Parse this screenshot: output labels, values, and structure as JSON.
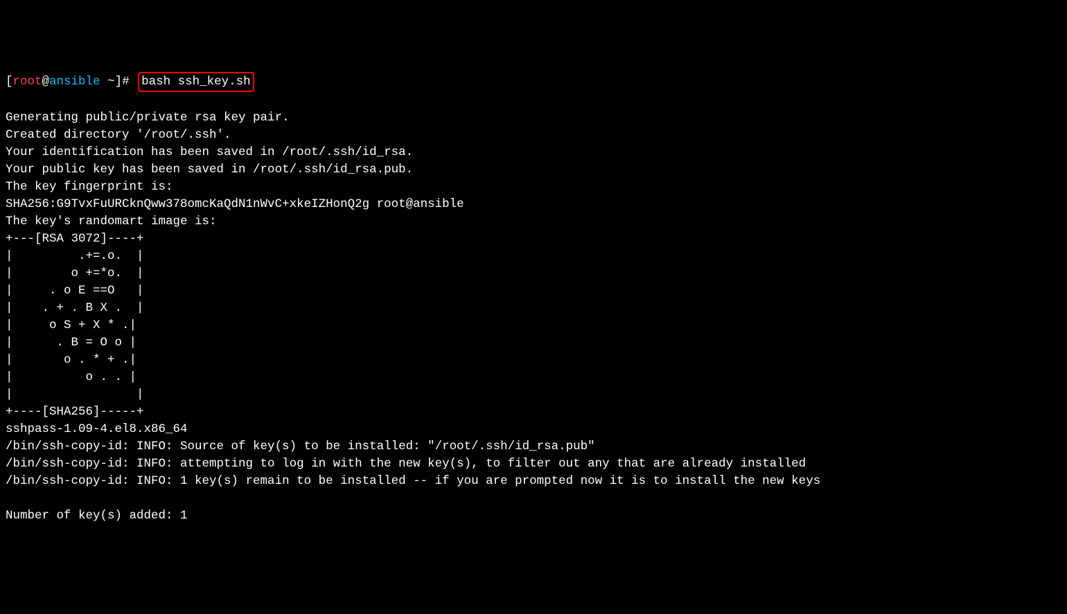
{
  "prompt": {
    "open_bracket": "[",
    "user": "root",
    "at": "@",
    "host": "ansible",
    "path": " ~",
    "close_bracket": "]",
    "hash": "# ",
    "command": "bash ssh_key.sh"
  },
  "output": [
    "Generating public/private rsa key pair.",
    "Created directory '/root/.ssh'.",
    "Your identification has been saved in /root/.ssh/id_rsa.",
    "Your public key has been saved in /root/.ssh/id_rsa.pub.",
    "The key fingerprint is:",
    "SHA256:G9TvxFuURCknQww378omcKaQdN1nWvC+xkeIZHonQ2g root@ansible",
    "The key's randomart image is:",
    "+---[RSA 3072]----+",
    "|         .+=.o.  |",
    "|        o +=*o.  |",
    "|     . o E ==O   |",
    "|    . + . B X .  |",
    "|     o S + X * .|",
    "|      . B = O o |",
    "|       o . * + .|",
    "|          o . . |",
    "|                 |",
    "+----[SHA256]-----+",
    "sshpass-1.09-4.el8.x86_64",
    "/bin/ssh-copy-id: INFO: Source of key(s) to be installed: \"/root/.ssh/id_rsa.pub\"",
    "/bin/ssh-copy-id: INFO: attempting to log in with the new key(s), to filter out any that are already installed",
    "/bin/ssh-copy-id: INFO: 1 key(s) remain to be installed -- if you are prompted now it is to install the new keys",
    "",
    "Number of key(s) added: 1"
  ]
}
